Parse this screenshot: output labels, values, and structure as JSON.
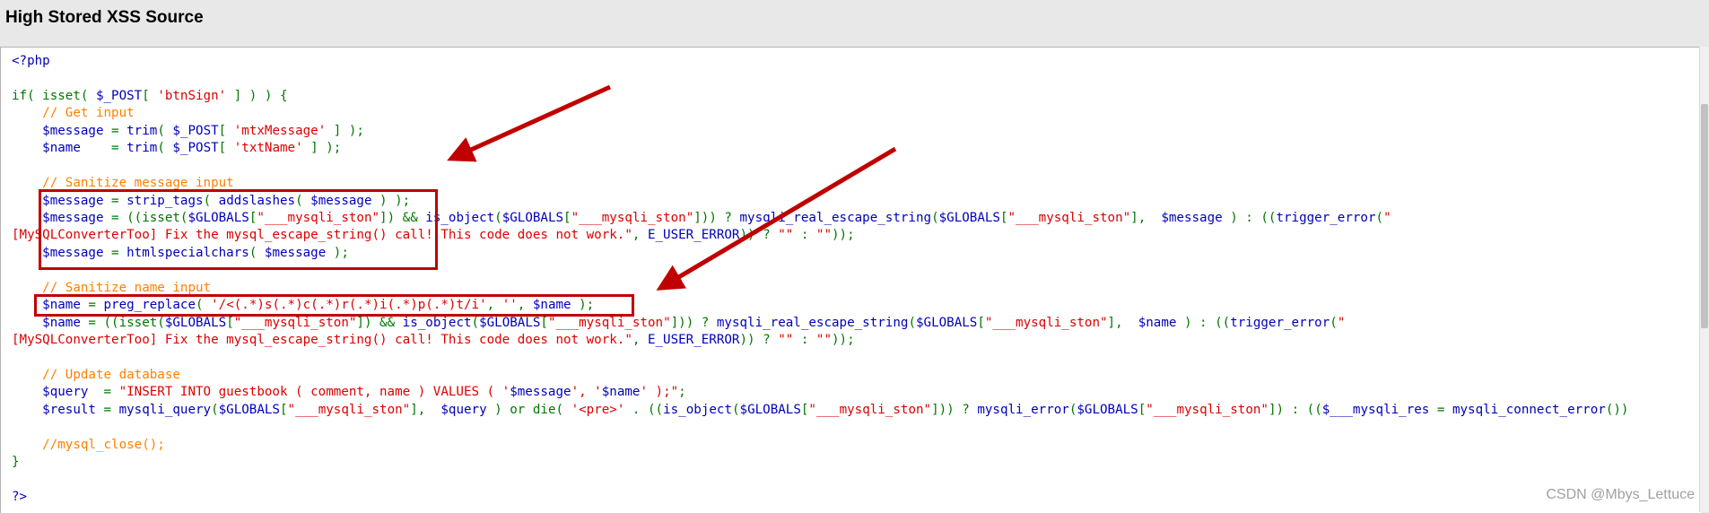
{
  "header": {
    "title": "High Stored XSS Source"
  },
  "code_lines": [
    [
      {
        "t": "<?php",
        "c": "v"
      }
    ],
    [],
    [
      {
        "t": "if( isset( ",
        "c": "k"
      },
      {
        "t": "$_POST",
        "c": "v"
      },
      {
        "t": "[ ",
        "c": "k"
      },
      {
        "t": "'btnSign'",
        "c": "s"
      },
      {
        "t": " ] ) ) {",
        "c": "k"
      }
    ],
    [
      {
        "t": "    // Get input",
        "c": "c"
      }
    ],
    [
      {
        "t": "    $message ",
        "c": "v"
      },
      {
        "t": "= ",
        "c": "k"
      },
      {
        "t": "trim",
        "c": "v"
      },
      {
        "t": "( ",
        "c": "k"
      },
      {
        "t": "$_POST",
        "c": "v"
      },
      {
        "t": "[ ",
        "c": "k"
      },
      {
        "t": "'mtxMessage'",
        "c": "s"
      },
      {
        "t": " ] );",
        "c": "k"
      }
    ],
    [
      {
        "t": "    $name    ",
        "c": "v"
      },
      {
        "t": "= ",
        "c": "k"
      },
      {
        "t": "trim",
        "c": "v"
      },
      {
        "t": "( ",
        "c": "k"
      },
      {
        "t": "$_POST",
        "c": "v"
      },
      {
        "t": "[ ",
        "c": "k"
      },
      {
        "t": "'txtName'",
        "c": "s"
      },
      {
        "t": " ] );",
        "c": "k"
      }
    ],
    [],
    [
      {
        "t": "    // Sanitize message input",
        "c": "c"
      }
    ],
    [
      {
        "t": "    $message ",
        "c": "v"
      },
      {
        "t": "= ",
        "c": "k"
      },
      {
        "t": "strip_tags",
        "c": "v"
      },
      {
        "t": "( ",
        "c": "k"
      },
      {
        "t": "addslashes",
        "c": "v"
      },
      {
        "t": "( ",
        "c": "k"
      },
      {
        "t": "$message ",
        "c": "v"
      },
      {
        "t": ") );",
        "c": "k"
      }
    ],
    [
      {
        "t": "    $message ",
        "c": "v"
      },
      {
        "t": "= ((isset(",
        "c": "k"
      },
      {
        "t": "$GLOBALS",
        "c": "v"
      },
      {
        "t": "[",
        "c": "k"
      },
      {
        "t": "\"___mysqli_ston\"",
        "c": "s"
      },
      {
        "t": "]) && ",
        "c": "k"
      },
      {
        "t": "is_object",
        "c": "v"
      },
      {
        "t": "(",
        "c": "k"
      },
      {
        "t": "$GLOBALS",
        "c": "v"
      },
      {
        "t": "[",
        "c": "k"
      },
      {
        "t": "\"___mysqli_ston\"",
        "c": "s"
      },
      {
        "t": "])) ? ",
        "c": "k"
      },
      {
        "t": "mysqli_real_escape_string",
        "c": "v"
      },
      {
        "t": "(",
        "c": "k"
      },
      {
        "t": "$GLOBALS",
        "c": "v"
      },
      {
        "t": "[",
        "c": "k"
      },
      {
        "t": "\"___mysqli_ston\"",
        "c": "s"
      },
      {
        "t": "],  ",
        "c": "k"
      },
      {
        "t": "$message ",
        "c": "v"
      },
      {
        "t": ") : ((",
        "c": "k"
      },
      {
        "t": "trigger_error",
        "c": "v"
      },
      {
        "t": "(",
        "c": "k"
      },
      {
        "t": "\"",
        "c": "s"
      }
    ],
    [
      {
        "t": "[MySQLConverterToo] Fix the mysql_escape_string() call! This code does not work.\"",
        "c": "s"
      },
      {
        "t": ", ",
        "c": "k"
      },
      {
        "t": "E_USER_ERROR",
        "c": "v"
      },
      {
        "t": ")) ? ",
        "c": "k"
      },
      {
        "t": "\"\"",
        "c": "s"
      },
      {
        "t": " : ",
        "c": "k"
      },
      {
        "t": "\"\"",
        "c": "s"
      },
      {
        "t": "));",
        "c": "k"
      }
    ],
    [
      {
        "t": "    $message ",
        "c": "v"
      },
      {
        "t": "= ",
        "c": "k"
      },
      {
        "t": "htmlspecialchars",
        "c": "v"
      },
      {
        "t": "( ",
        "c": "k"
      },
      {
        "t": "$message ",
        "c": "v"
      },
      {
        "t": ");",
        "c": "k"
      }
    ],
    [],
    [
      {
        "t": "    // Sanitize name input",
        "c": "c"
      }
    ],
    [
      {
        "t": "    $name ",
        "c": "v"
      },
      {
        "t": "= ",
        "c": "k"
      },
      {
        "t": "preg_replace",
        "c": "v"
      },
      {
        "t": "( ",
        "c": "k"
      },
      {
        "t": "'/<(.*)s(.*)c(.*)r(.*)i(.*)p(.*)t/i'",
        "c": "s"
      },
      {
        "t": ", ",
        "c": "k"
      },
      {
        "t": "''",
        "c": "s"
      },
      {
        "t": ", ",
        "c": "k"
      },
      {
        "t": "$name ",
        "c": "v"
      },
      {
        "t": ");",
        "c": "k"
      }
    ],
    [
      {
        "t": "    $name ",
        "c": "v"
      },
      {
        "t": "= ((isset(",
        "c": "k"
      },
      {
        "t": "$GLOBALS",
        "c": "v"
      },
      {
        "t": "[",
        "c": "k"
      },
      {
        "t": "\"___mysqli_ston\"",
        "c": "s"
      },
      {
        "t": "]) && ",
        "c": "k"
      },
      {
        "t": "is_object",
        "c": "v"
      },
      {
        "t": "(",
        "c": "k"
      },
      {
        "t": "$GLOBALS",
        "c": "v"
      },
      {
        "t": "[",
        "c": "k"
      },
      {
        "t": "\"___mysqli_ston\"",
        "c": "s"
      },
      {
        "t": "])) ? ",
        "c": "k"
      },
      {
        "t": "mysqli_real_escape_string",
        "c": "v"
      },
      {
        "t": "(",
        "c": "k"
      },
      {
        "t": "$GLOBALS",
        "c": "v"
      },
      {
        "t": "[",
        "c": "k"
      },
      {
        "t": "\"___mysqli_ston\"",
        "c": "s"
      },
      {
        "t": "],  ",
        "c": "k"
      },
      {
        "t": "$name ",
        "c": "v"
      },
      {
        "t": ") : ((",
        "c": "k"
      },
      {
        "t": "trigger_error",
        "c": "v"
      },
      {
        "t": "(",
        "c": "k"
      },
      {
        "t": "\"",
        "c": "s"
      }
    ],
    [
      {
        "t": "[MySQLConverterToo] Fix the mysql_escape_string() call! This code does not work.\"",
        "c": "s"
      },
      {
        "t": ", ",
        "c": "k"
      },
      {
        "t": "E_USER_ERROR",
        "c": "v"
      },
      {
        "t": ")) ? ",
        "c": "k"
      },
      {
        "t": "\"\"",
        "c": "s"
      },
      {
        "t": " : ",
        "c": "k"
      },
      {
        "t": "\"\"",
        "c": "s"
      },
      {
        "t": "));",
        "c": "k"
      }
    ],
    [],
    [
      {
        "t": "    // Update database",
        "c": "c"
      }
    ],
    [
      {
        "t": "    $query  ",
        "c": "v"
      },
      {
        "t": "= ",
        "c": "k"
      },
      {
        "t": "\"INSERT INTO guestbook ( comment, name ) VALUES ( '",
        "c": "s"
      },
      {
        "t": "$message",
        "c": "v"
      },
      {
        "t": "', '",
        "c": "s"
      },
      {
        "t": "$name",
        "c": "v"
      },
      {
        "t": "' );\"",
        "c": "s"
      },
      {
        "t": ";",
        "c": "k"
      }
    ],
    [
      {
        "t": "    $result ",
        "c": "v"
      },
      {
        "t": "= ",
        "c": "k"
      },
      {
        "t": "mysqli_query",
        "c": "v"
      },
      {
        "t": "(",
        "c": "k"
      },
      {
        "t": "$GLOBALS",
        "c": "v"
      },
      {
        "t": "[",
        "c": "k"
      },
      {
        "t": "\"___mysqli_ston\"",
        "c": "s"
      },
      {
        "t": "],  ",
        "c": "k"
      },
      {
        "t": "$query ",
        "c": "v"
      },
      {
        "t": ") or die( ",
        "c": "k"
      },
      {
        "t": "'<pre>'",
        "c": "s"
      },
      {
        "t": " . ((",
        "c": "k"
      },
      {
        "t": "is_object",
        "c": "v"
      },
      {
        "t": "(",
        "c": "k"
      },
      {
        "t": "$GLOBALS",
        "c": "v"
      },
      {
        "t": "[",
        "c": "k"
      },
      {
        "t": "\"___mysqli_ston\"",
        "c": "s"
      },
      {
        "t": "])) ? ",
        "c": "k"
      },
      {
        "t": "mysqli_error",
        "c": "v"
      },
      {
        "t": "(",
        "c": "k"
      },
      {
        "t": "$GLOBALS",
        "c": "v"
      },
      {
        "t": "[",
        "c": "k"
      },
      {
        "t": "\"___mysqli_ston\"",
        "c": "s"
      },
      {
        "t": "]) : ((",
        "c": "k"
      },
      {
        "t": "$___mysqli_res ",
        "c": "v"
      },
      {
        "t": "= ",
        "c": "k"
      },
      {
        "t": "mysqli_connect_error",
        "c": "v"
      },
      {
        "t": "())",
        "c": "k"
      }
    ],
    [],
    [
      {
        "t": "    //mysql_close();",
        "c": "c"
      }
    ],
    [
      {
        "t": "}",
        "c": "k"
      }
    ],
    [],
    [
      {
        "t": "?>",
        "c": "v"
      }
    ]
  ],
  "watermark": "CSDN @Mbys_Lettuce",
  "colors": {
    "keyword": "#007700",
    "comment": "#ff8000",
    "string": "#dd0000",
    "variable": "#0000bb",
    "annotation_red": "#c00000"
  }
}
